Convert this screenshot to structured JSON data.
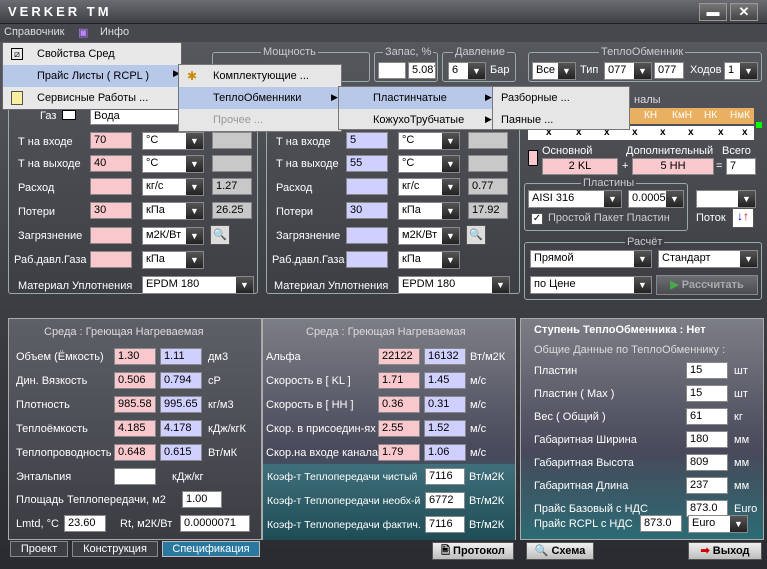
{
  "app": {
    "title": "VERKER  TM",
    "minimize": "▬",
    "close": "✕"
  },
  "menubar": {
    "items": [
      "Справочник",
      "Инфо"
    ]
  },
  "main_menu": {
    "items": [
      "Свойства  Сред",
      "Прайс  Листы ( RCPL )",
      "Сервисные  Работы  ..."
    ]
  },
  "sub1": {
    "items": [
      "Комплектующие  ...",
      "ТеплоОбменники",
      "Прочее ..."
    ]
  },
  "sub2": {
    "items": [
      "Пластинчатые",
      "КожухоТрубчатые"
    ]
  },
  "sub3": {
    "items": [
      "Разборные  ...",
      "Паяные  ..."
    ]
  },
  "top": {
    "power_label": "Мощность",
    "zapas_label": "Запас, %",
    "zapas_value": "5.087",
    "pressure_label": "Давление",
    "pressure_value": "6",
    "pressure_unit": "Бар",
    "he_label": "ТеплоОбменник",
    "he_all": "Все",
    "he_type_label": "Тип",
    "he_type1": "077",
    "he_type2": "077",
    "he_hodov_label": "Ходов",
    "he_hodov": "1",
    "channels_label": "налы",
    "channels_heads": [
      "КН",
      "КмН",
      "НК",
      "НмК"
    ]
  },
  "left": {
    "gas_label": "Газ",
    "gas_value": "Вода",
    "t_in_label": "Т на входе",
    "t_in": "70",
    "t_unit": "°С",
    "t_out_label": "Т на выходе",
    "t_out": "40",
    "flow_label": "Расход",
    "flow_unit": "кг/с",
    "flow_calc": "1.27",
    "loss_label": "Потери",
    "loss": "30",
    "loss_unit": "кПа",
    "loss_calc": "26.25",
    "fouling_label": "Загрязнение",
    "fouling_unit": "м2К/Вт",
    "gas_pressure_label": "Раб.давл.Газа",
    "gas_pressure_unit": "кПа",
    "seal_label": "Материал Уплотнения",
    "seal": "EPDM 180"
  },
  "right": {
    "t_in_label": "Т на входе",
    "t_in": "5",
    "t_unit": "°С",
    "t_out_label": "Т на выходе",
    "t_out": "55",
    "flow_label": "Расход",
    "flow_unit": "кг/с",
    "flow_calc": "0.77",
    "loss_label": "Потери",
    "loss": "30",
    "loss_unit": "кПа",
    "loss_calc": "17.92",
    "fouling_label": "Загрязнение",
    "fouling_unit": "м2К/Вт",
    "gas_pressure_label": "Раб.давл.Газа",
    "gas_pressure_unit": "кПа",
    "seal_label": "Материал Уплотнения",
    "seal": "EPDM 180"
  },
  "plates": {
    "main_label": "Основной",
    "main_value": "2 KL",
    "extra_label": "Дополнительный",
    "extra_value": "5 HH",
    "total_label": "Всего",
    "total_value": "7",
    "plates_label": "Пластины",
    "material": "AISI 316",
    "thickness": "0.0005",
    "simple_label": "Простой Пакет Пластин",
    "flow_label": "Поток"
  },
  "calc": {
    "label": "Расчёт",
    "mode": "Прямой",
    "standard": "Стандарт",
    "by": "по Цене",
    "button": "Рассчитать"
  },
  "env_left": {
    "header": "Среда :  Греющая  Нагреваемая",
    "rows": [
      {
        "label": "Объем  (Ёмкость)",
        "v1": "1.30",
        "v2": "1.11",
        "unit": "дм3"
      },
      {
        "label": "Дин. Вязкость",
        "v1": "0.506",
        "v2": "0.794",
        "unit": "cP"
      },
      {
        "label": "Плотность",
        "v1": "985.58",
        "v2": "995.65",
        "unit": "кг/м3"
      },
      {
        "label": "Теплоёмкость",
        "v1": "4.185",
        "v2": "4.178",
        "unit": "кДж/кгК"
      },
      {
        "label": "Теплопроводность",
        "v1": "0.648",
        "v2": "0.615",
        "unit": "Вт/мК"
      },
      {
        "label": "Энтальпия",
        "v1": "",
        "v2": "",
        "unit": "кДж/кг"
      }
    ],
    "area_label": "Площадь Теплопередачи,  м2",
    "area": "1.00",
    "lmtd_label": "Lmtd, °С",
    "lmtd": "23.60",
    "rt_label": "Rt, м2К/Вт",
    "rt": "0.0000071"
  },
  "env_mid": {
    "header": "Среда :  Греющая  Нагреваемая",
    "rows": [
      {
        "label": "Альфа",
        "v1": "22122",
        "v2": "16132",
        "unit": "Вт/м2К"
      },
      {
        "label": "Скорость в    [ KL ]",
        "v1": "1.71",
        "v2": "1.45",
        "unit": "м/с"
      },
      {
        "label": "Скорость в    [ HH ]",
        "v1": "0.36",
        "v2": "0.31",
        "unit": "м/с"
      },
      {
        "label": "Скор. в присоедин-ях",
        "v1": "2.55",
        "v2": "1.52",
        "unit": "м/с"
      },
      {
        "label": "Скор.на входе канала",
        "v1": "1.79",
        "v2": "1.06",
        "unit": "м/с"
      }
    ],
    "k_rows": [
      {
        "label": "Коэф-т Теплопередачи чистый",
        "v": "7116",
        "unit": "Вт/м2К"
      },
      {
        "label": "Коэф-т Теплопередачи необх-й",
        "v": "6772",
        "unit": "Вт/м2К"
      },
      {
        "label": "Коэф-т Теплопередачи фактич.",
        "v": "7116",
        "unit": "Вт/м2К"
      }
    ]
  },
  "stage": {
    "header": "Ступень  ТеплоОбменника :  Нет",
    "subheader": "Общие  Данные  по  ТеплоОбменнику :",
    "rows": [
      {
        "label": "Пластин",
        "v": "15",
        "unit": "шт"
      },
      {
        "label": "Пластин  ( Max )",
        "v": "15",
        "unit": "шт"
      },
      {
        "label": "Вес  ( Общий )",
        "v": "61",
        "unit": "кг"
      },
      {
        "label": "Габаритная  Ширина",
        "v": "180",
        "unit": "мм"
      },
      {
        "label": "Габаритная  Высота",
        "v": "809",
        "unit": "мм"
      },
      {
        "label": "Габаритная  Длина",
        "v": "237",
        "unit": "мм"
      },
      {
        "label": "Прайс Базовый с НДС",
        "v": "873.0",
        "unit": "Euro"
      }
    ],
    "rcpl_label": "Прайс RCPL с НДС",
    "rcpl": "873.0",
    "currency": "Euro"
  },
  "tabs": {
    "items": [
      "Проект",
      "Конструкция",
      "Спецификация"
    ]
  },
  "footer": {
    "protocol": "Протокол",
    "scheme": "Схема",
    "exit": "Выход"
  },
  "colors": {
    "pink": "#f8c8cc",
    "blue": "#cfd0ff",
    "teal": "#2b6b74"
  }
}
